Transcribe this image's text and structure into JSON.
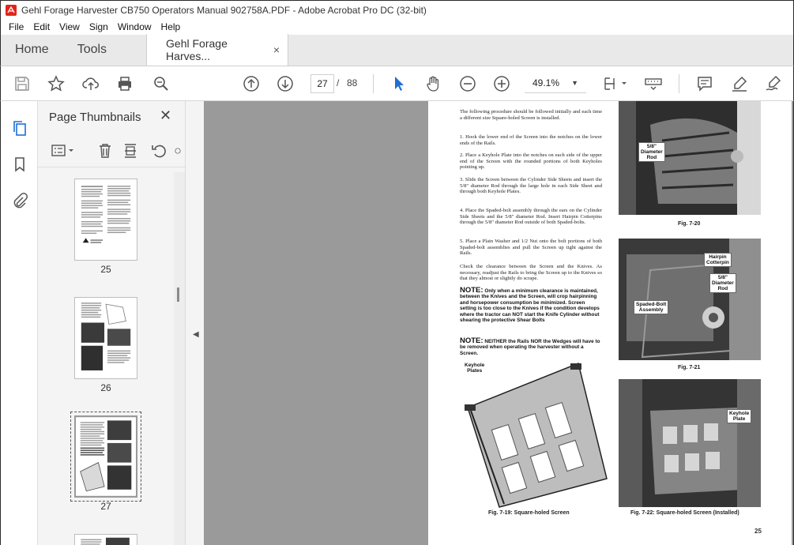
{
  "window": {
    "title": "Gehl Forage Harvester CB750 Operators Manual 902758A.PDF - Adobe Acrobat Pro DC (32-bit)"
  },
  "menu": [
    "File",
    "Edit",
    "View",
    "Sign",
    "Window",
    "Help"
  ],
  "tabs": {
    "home": "Home",
    "tools": "Tools",
    "document": "Gehl Forage Harves...",
    "close": "×"
  },
  "toolbar": {
    "current_page": "27",
    "separator": "/",
    "total_pages": "88",
    "zoom": "49.1%"
  },
  "panel": {
    "title": "Page Thumbnails",
    "close": "✕",
    "thumbnails": [
      {
        "label": "25"
      },
      {
        "label": "26"
      },
      {
        "label": "27",
        "selected": true
      }
    ]
  },
  "document": {
    "intro": "The following procedure should be followed initially and each time a different size Square-holed Screen is installed.",
    "steps": [
      "1.   Hook the lower end of the Screen into the notches on the lower ends of the Rails.",
      "2.   Place a Keyhole Plate into the notches on each side of the upper end of the Screen with the rounded portions of both Keyholes pointing up.",
      "3.   Slide the Screen between the Cylinder Side Sheets and insert the 5/8\" diameter Rod through the large hole in each Side Sheet and through both Keyhole Plates.",
      "4.   Place the Spaded-bolt assembly through the ears on the Cylinder Side Sheets and the 5/8\" diameter Rod. Insert Hairpin Cotterpins through the 5/8\" diameter Rod outside of both Spaded-bolts.",
      "5.   Place a Plain Washer and 1/2 Nut onto the bolt portions of both Spaded-bolt assemblies and pull the Screen up tight against the Rails."
    ],
    "check": "Check the clearance between the Screen and the Knives. As necessary, readjust the Rails to bring the Screen up to the Knives so that they almost or slightly do scrape.",
    "note1_label": "NOTE:",
    "note1": "Only when a minimum clearance is maintained, between the Knives and the Screen, will crop hairpinning and horsepower consumption be minimized. Screen setting is too close to the Knives if the condition develops where the tractor can NOT start the Knife Cylinder without shearing the protective Shear Bolts",
    "note2_label": "NOTE:",
    "note2": "NEITHER the Rails NOR the Wedges will have to be removed when operating the harvester without a Screen.",
    "callouts": {
      "rod": "5/8\"\nDiameter\nRod",
      "hairpin": "Hairpin\nCotterpin",
      "rod2": "5/8\"\nDiameter\nRod",
      "spaded": "Spaded-Bolt\nAssembly",
      "keyhole_plates": "Keyhole\nPlates",
      "keyhole_plate": "Keyhole\nPlate"
    },
    "captions": {
      "fig20": "Fig. 7-20",
      "fig21": "Fig. 7-21",
      "fig19": "Fig. 7-19: Square-holed Screen",
      "fig22": "Fig. 7-22: Square-holed Screen (Installed)"
    },
    "page_number": "25"
  }
}
